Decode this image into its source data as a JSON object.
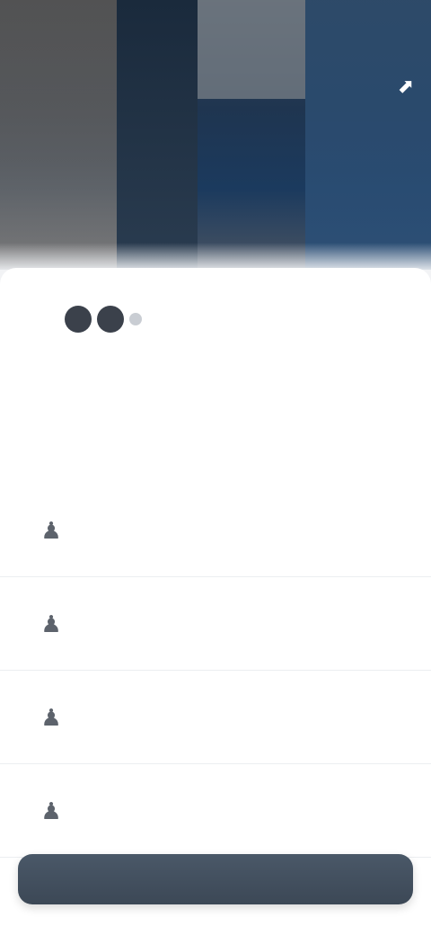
{
  "hero": {
    "title": "",
    "subtitle": "",
    "meta": "",
    "action_icon": "share-icon"
  },
  "stats": {
    "rating": {
      "label": "",
      "value": 2,
      "max": 3
    },
    "top_right": {
      "label": "",
      "value": ""
    },
    "bottom_left": {
      "label": "",
      "value": ""
    },
    "bottom_right": {
      "label": "",
      "value": ""
    }
  },
  "list": {
    "items": [
      {
        "label": "",
        "icon": "person-icon"
      },
      {
        "label": "",
        "icon": "person-icon"
      },
      {
        "label": "",
        "icon": "person-icon"
      },
      {
        "label": "",
        "icon": "person-icon"
      }
    ]
  },
  "cta": {
    "label": ""
  },
  "colors": {
    "hero_dark": "#1b3a5e",
    "card_bg": "#ffffff",
    "cta_bg": "#4a5868",
    "text_primary": "#4a4f58",
    "text_secondary": "#8a9098"
  }
}
